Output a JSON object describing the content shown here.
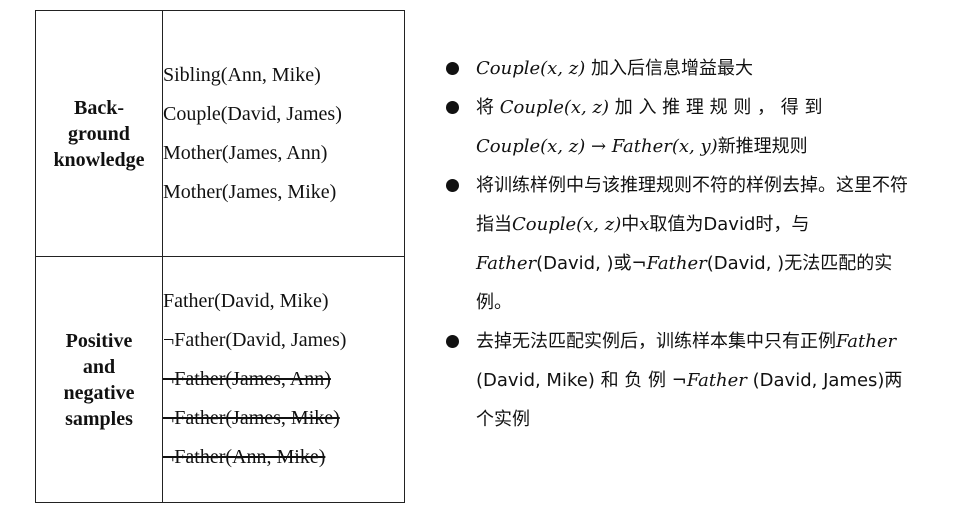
{
  "table": {
    "background_label": "Back-\nground\nknowledge",
    "background_facts": [
      "Sibling(Ann, Mike)",
      "Couple(David, James)",
      "Mother(James, Ann)",
      "Mother(James, Mike)"
    ],
    "samples_label": "Positive\nand\nnegative\nsamples",
    "sample_facts": [
      {
        "text": "Father(David, Mike)",
        "struck": false
      },
      {
        "text": "¬Father(David, James)",
        "struck": false
      },
      {
        "text": "¬Father(James, Ann)",
        "struck": true
      },
      {
        "text": "¬Father(James, Mike)",
        "struck": true
      },
      {
        "text": "¬Father(Ann, Mike)",
        "struck": true
      }
    ]
  },
  "bullets": {
    "b1": {
      "m1": "Couple(x, z)",
      "t1": " 加入后信息增益最大"
    },
    "b2": {
      "t1": "将 ",
      "m1": "Couple(x, z)",
      "t2": " 加 入 推 理 规 则 ， 得 到",
      "m2": "Couple(x, z) → Father(x, y)",
      "t3": "新推理规则"
    },
    "b3": {
      "t1": "将训练样例中与该推理规则不符的样例去掉。这里不符指当",
      "m1": "Couple(x, z)",
      "t2": "中",
      "m2": "x",
      "t3": "取值为David时，与",
      "m3": "Father",
      "t4": "(David, )或¬",
      "m4": "Father",
      "t5": "(David, )无法匹配的实例。"
    },
    "b4": {
      "t1": "去掉无法匹配实例后，训练样本集中只有正例",
      "m1": "Father",
      "t2": " (David, Mike) 和 负 例 ¬",
      "m2": "Father",
      "t3": " (David, James)两个实例"
    }
  }
}
